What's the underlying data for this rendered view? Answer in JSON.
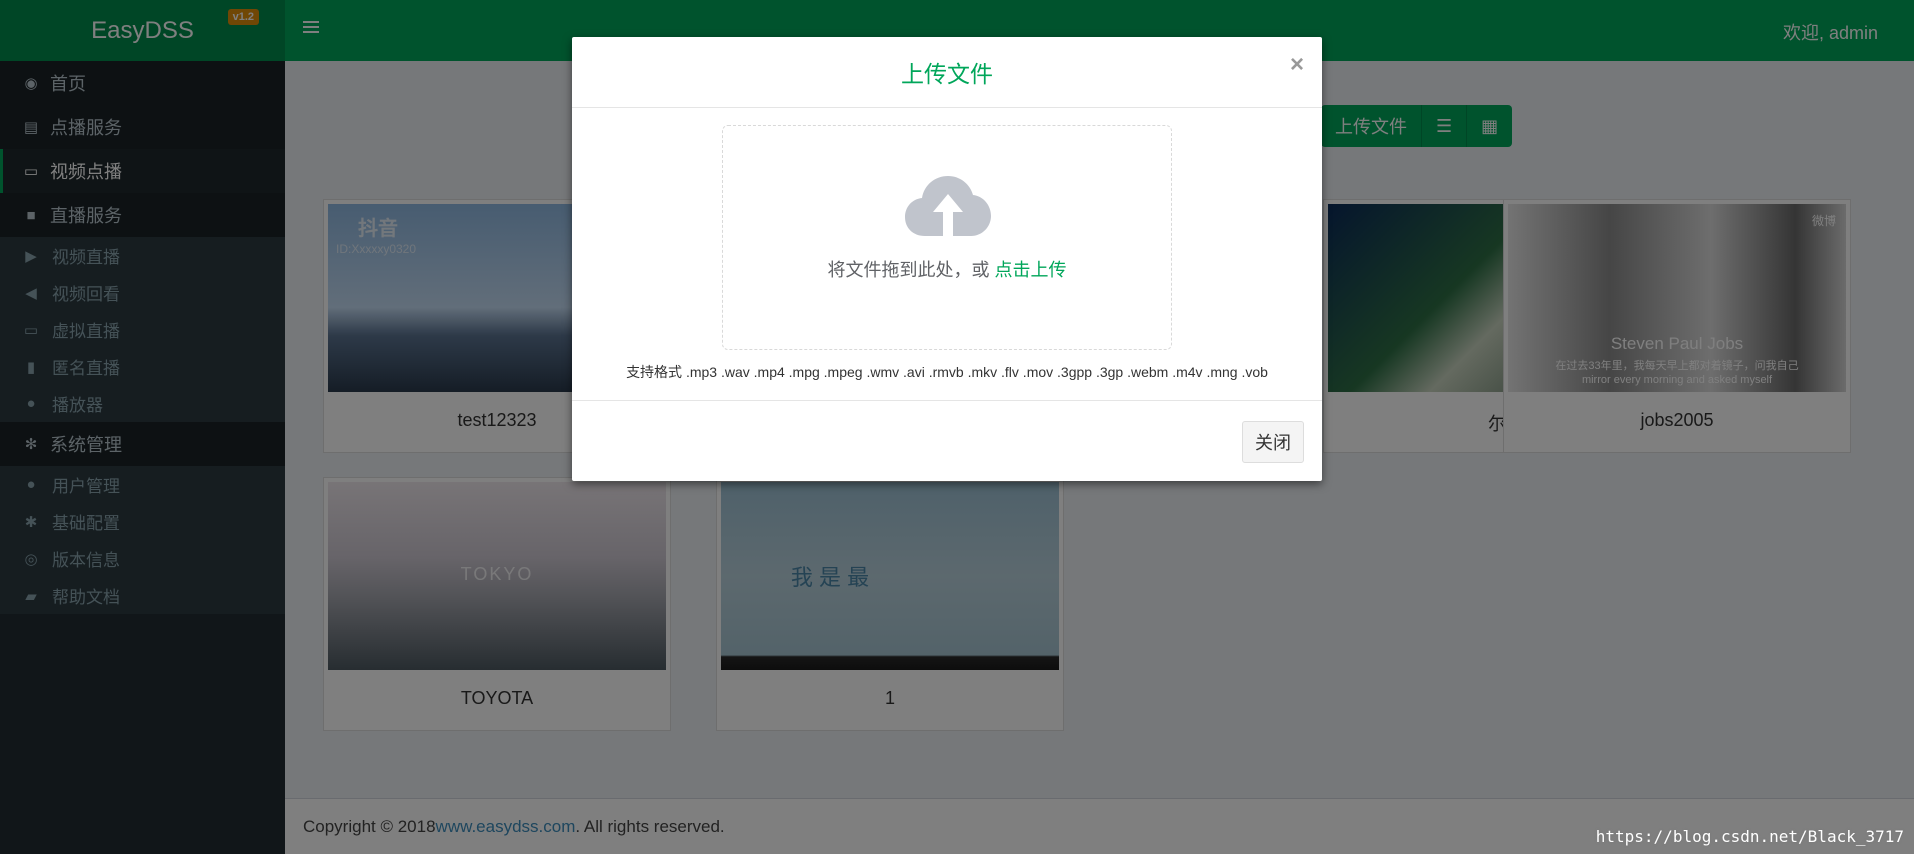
{
  "app": {
    "name": "EasyDSS",
    "version": "v1.2"
  },
  "header": {
    "welcome": "欢迎, admin"
  },
  "sidebar": {
    "items": [
      {
        "label": "首页",
        "icon": "dashboard-icon"
      },
      {
        "label": "点播服务",
        "icon": "film-icon"
      },
      {
        "label": "视频点播",
        "icon": "monitor-icon"
      },
      {
        "label": "直播服务",
        "icon": "video-camera-icon"
      },
      {
        "label": "视频直播",
        "icon": "play-square-icon"
      },
      {
        "label": "视频回看",
        "icon": "backward-icon"
      },
      {
        "label": "虚拟直播",
        "icon": "laptop-icon"
      },
      {
        "label": "匿名直播",
        "icon": "lock-icon"
      },
      {
        "label": "播放器",
        "icon": "play-circle-icon"
      },
      {
        "label": "系统管理",
        "icon": "cogs-icon"
      },
      {
        "label": "用户管理",
        "icon": "users-icon"
      },
      {
        "label": "基础配置",
        "icon": "gear-icon"
      },
      {
        "label": "版本信息",
        "icon": "globe-icon"
      },
      {
        "label": "帮助文档",
        "icon": "book-icon"
      }
    ]
  },
  "toolbar": {
    "upload_label": "上传文件",
    "list_view_icon": "list-icon",
    "grid_view_icon": "grid-icon"
  },
  "videos": [
    {
      "name": "test12323",
      "watermark": "抖音",
      "watermark_id": "ID:Xxxxxy0320"
    },
    {
      "name": "尔"
    },
    {
      "name": "jobs2005",
      "overlay_title": "Steven Paul Jobs",
      "overlay_sub1": "在过去33年里，我每天早上都对着镜子，问我自己",
      "overlay_sub2": "mirror every morning and asked myself",
      "corner_tag": "微博"
    },
    {
      "name": "TOYOTA",
      "overlay_title": "TOKYO"
    },
    {
      "name": "1",
      "overlay_title": "我 是 最"
    }
  ],
  "modal": {
    "title": "上传文件",
    "close_symbol": "×",
    "drop_hint": "将文件拖到此处，或",
    "upload_link": "点击上传",
    "formats": "支持格式 .mp3 .wav .mp4 .mpg .mpeg .wmv .avi .rmvb .mkv .flv .mov .3gpp .3gp .webm .m4v .mng .vob",
    "close_button": "关闭"
  },
  "footer": {
    "prefix": "Copyright © 2018 ",
    "link": "www.easydss.com",
    "suffix": ". All rights reserved."
  },
  "watermark": "https://blog.csdn.net/Black_3717"
}
